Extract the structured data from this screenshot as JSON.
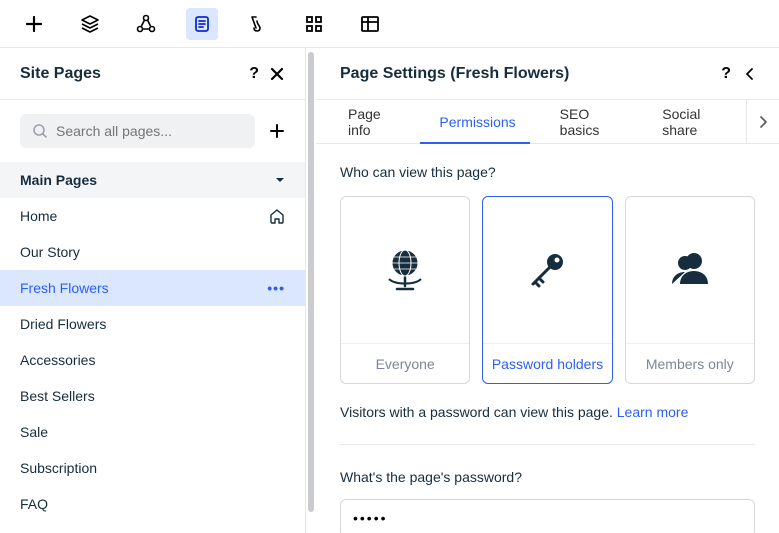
{
  "toolbar": {
    "icons": [
      "plus",
      "layers",
      "share-nodes",
      "document",
      "design",
      "grid",
      "table"
    ]
  },
  "left_panel": {
    "title": "Site Pages",
    "search_placeholder": "Search all pages...",
    "section_title": "Main Pages",
    "pages": [
      {
        "label": "Home",
        "icon": "home"
      },
      {
        "label": "Our Story"
      },
      {
        "label": "Fresh Flowers",
        "selected": true,
        "icon": "dots"
      },
      {
        "label": "Dried Flowers"
      },
      {
        "label": "Accessories"
      },
      {
        "label": "Best Sellers"
      },
      {
        "label": "Sale"
      },
      {
        "label": "Subscription"
      },
      {
        "label": "FAQ"
      }
    ]
  },
  "right_panel": {
    "title": "Page Settings (Fresh Flowers)",
    "tabs": [
      {
        "label": "Page info"
      },
      {
        "label": "Permissions",
        "active": true
      },
      {
        "label": "SEO basics"
      },
      {
        "label": "Social share"
      }
    ],
    "permissions": {
      "question": "Who can view this page?",
      "options": [
        {
          "label": "Everyone",
          "icon": "globe"
        },
        {
          "label": "Password holders",
          "icon": "key",
          "selected": true
        },
        {
          "label": "Members only",
          "icon": "members"
        }
      ],
      "description": "Visitors with a password can view this page. ",
      "learn_more": "Learn more",
      "password_label": "What's the page's password?",
      "password_value": "•••••"
    }
  }
}
